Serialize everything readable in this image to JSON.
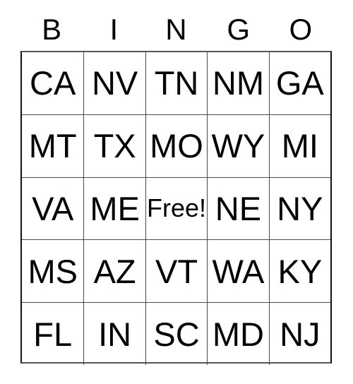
{
  "card": {
    "title": "BINGO",
    "columns": [
      {
        "letter": "B"
      },
      {
        "letter": "I"
      },
      {
        "letter": "N"
      },
      {
        "letter": "G"
      },
      {
        "letter": "O"
      }
    ],
    "rows": [
      [
        {
          "value": "CA",
          "free": false
        },
        {
          "value": "NV",
          "free": false
        },
        {
          "value": "TN",
          "free": false
        },
        {
          "value": "NM",
          "free": false
        },
        {
          "value": "GA",
          "free": false
        }
      ],
      [
        {
          "value": "MT",
          "free": false
        },
        {
          "value": "TX",
          "free": false
        },
        {
          "value": "MO",
          "free": false
        },
        {
          "value": "WY",
          "free": false
        },
        {
          "value": "MI",
          "free": false
        }
      ],
      [
        {
          "value": "VA",
          "free": false
        },
        {
          "value": "ME",
          "free": false
        },
        {
          "value": "Free!",
          "free": true
        },
        {
          "value": "NE",
          "free": false
        },
        {
          "value": "NY",
          "free": false
        }
      ],
      [
        {
          "value": "MS",
          "free": false
        },
        {
          "value": "AZ",
          "free": false
        },
        {
          "value": "VT",
          "free": false
        },
        {
          "value": "WA",
          "free": false
        },
        {
          "value": "KY",
          "free": false
        }
      ],
      [
        {
          "value": "FL",
          "free": false
        },
        {
          "value": "IN",
          "free": false
        },
        {
          "value": "SC",
          "free": false
        },
        {
          "value": "MD",
          "free": false
        },
        {
          "value": "NJ",
          "free": false
        }
      ]
    ],
    "colors": {
      "background": "#ffffff",
      "text": "#000000",
      "grid_line": "#4a4a4a",
      "border": "#111111"
    }
  }
}
